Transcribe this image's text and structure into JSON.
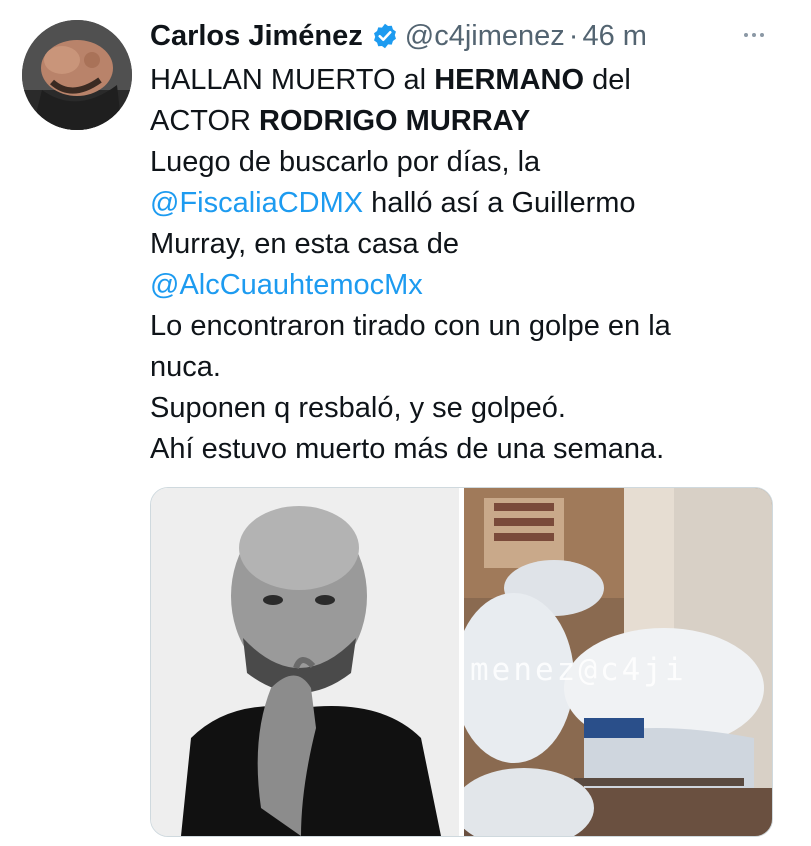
{
  "tweet": {
    "author": {
      "name": "Carlos Jiménez",
      "handle": "@c4jimenez",
      "separator": "·",
      "time": "46 m",
      "verified": true,
      "verified_icon": "verified-badge-icon",
      "verified_color": "#1d9bf0"
    },
    "more_icon": "more-options-icon",
    "text": {
      "l1_a": "HALLAN MUERTO al ",
      "l1_b": "HERMANO",
      "l1_c": " del",
      "l2_a": "ACTOR ",
      "l2_b": "RODRIGO MURRAY",
      "l3": "Luego de buscarlo por días, la",
      "mention1": "@FiscaliaCDMX",
      "l4_rest": " halló así a Guillermo",
      "l5": "Murray, en esta casa de",
      "mention2": "@AlcCuauhtemocMx",
      "l7": "Lo encontraron tirado con un golpe en la",
      "l8": "nuca.",
      "l9": "Suponen q resbaló, y se golpeó.",
      "l10": "Ahí estuvo muerto más de una semana."
    },
    "media": {
      "watermark": "menez@c4ji"
    },
    "colors": {
      "text": "#0f1419",
      "secondary": "#536471",
      "link": "#1d9bf0"
    }
  }
}
